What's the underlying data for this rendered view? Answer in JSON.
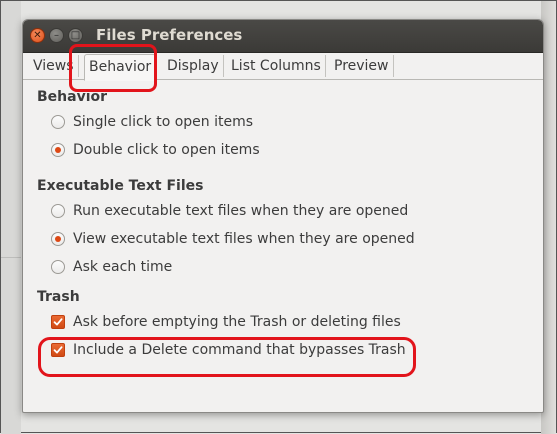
{
  "window": {
    "title": "Files Preferences"
  },
  "tabs": [
    {
      "label": "Views"
    },
    {
      "label": "Behavior"
    },
    {
      "label": "Display"
    },
    {
      "label": "List Columns"
    },
    {
      "label": "Preview"
    }
  ],
  "active_tab": "Behavior",
  "behavior": {
    "heading": "Behavior",
    "options": [
      {
        "label": "Single click to open items",
        "selected": false
      },
      {
        "label": "Double click to open items",
        "selected": true
      }
    ]
  },
  "executable": {
    "heading": "Executable Text Files",
    "options": [
      {
        "label": "Run executable text files when they are opened",
        "selected": false
      },
      {
        "label": "View executable text files when they are opened",
        "selected": true
      },
      {
        "label": "Ask each time",
        "selected": false
      }
    ]
  },
  "trash": {
    "heading": "Trash",
    "options": [
      {
        "label": "Ask before emptying the Trash or deleting files",
        "checked": true
      },
      {
        "label": "Include a Delete command that bypasses Trash",
        "checked": true
      }
    ]
  },
  "colors": {
    "accent": "#dd4814",
    "annotation": "#e2141b",
    "titlebar": "#3b3a37"
  }
}
